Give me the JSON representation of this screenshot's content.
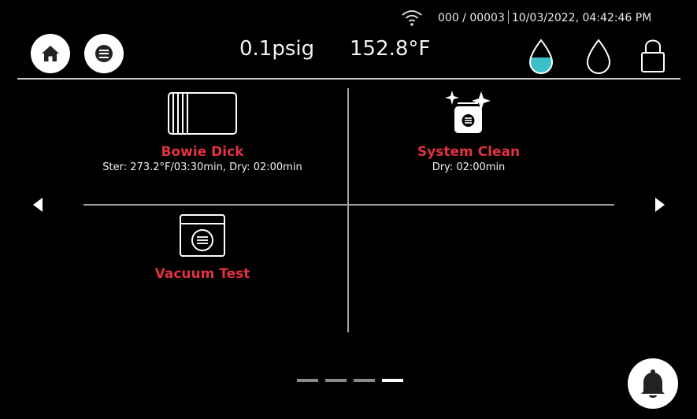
{
  "status": {
    "counter": "000 / 00003",
    "datetime": "10/03/2022, 04:42:46 PM"
  },
  "header": {
    "pressure": "0.1psig",
    "temperature": "152.8°F"
  },
  "cycles": [
    {
      "title": "Bowie Dick",
      "subtitle": "Ster: 273.2°F/03:30min, Dry: 02:00min",
      "icon": "bowie-dick-pack-icon"
    },
    {
      "title": "System Clean",
      "subtitle": "Dry: 02:00min",
      "icon": "system-clean-sparkle-icon"
    },
    {
      "title": "Vacuum Test",
      "subtitle": "",
      "icon": "vacuum-test-chamber-icon"
    }
  ],
  "pager": {
    "pages": 4,
    "active_page": 4
  },
  "icons": {
    "wifi": "wifi-icon",
    "home": "home-icon",
    "menu": "menu-icon",
    "water_filled": "water-drop-filled-icon",
    "water_empty": "water-drop-empty-icon",
    "lock": "lock-icon",
    "bell": "bell-icon"
  },
  "colors": {
    "accent_red": "#e0323f",
    "water_fill": "#3cc0c8"
  }
}
